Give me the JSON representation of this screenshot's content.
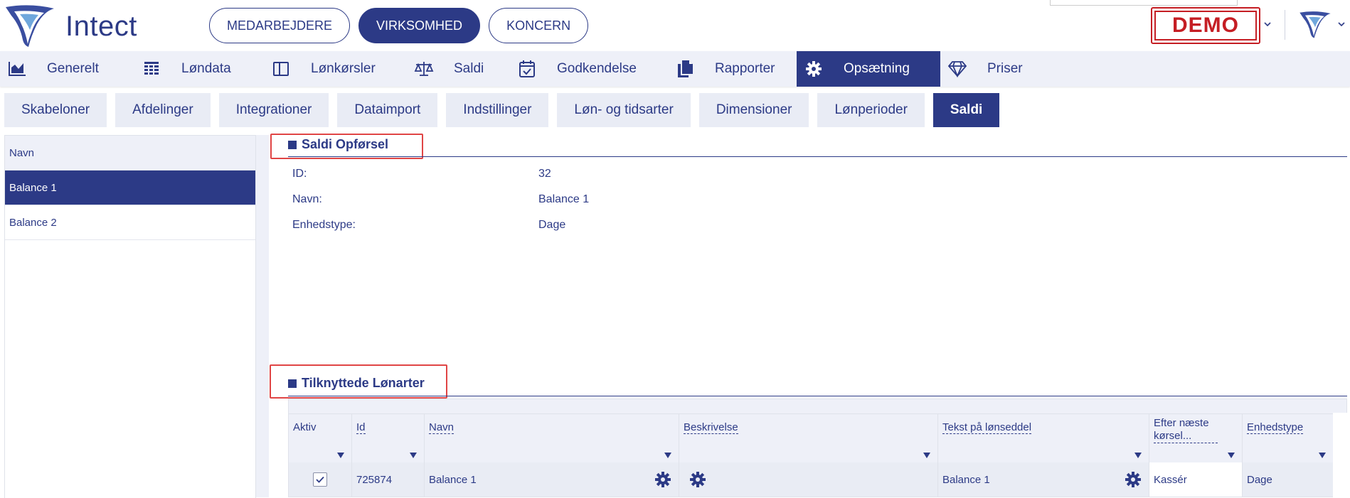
{
  "app": {
    "name": "Intect"
  },
  "modes": [
    {
      "label": "MEDARBEJDERE",
      "active": false
    },
    {
      "label": "VIRKSOMHED",
      "active": true
    },
    {
      "label": "KONCERN",
      "active": false
    }
  ],
  "demo_label": "DEMO",
  "main_nav": [
    {
      "label": "Generelt",
      "icon": "chart-icon",
      "active": false
    },
    {
      "label": "Løndata",
      "icon": "table-icon",
      "active": false
    },
    {
      "label": "Lønkørsler",
      "icon": "window-icon",
      "active": false
    },
    {
      "label": "Saldi",
      "icon": "scale-icon",
      "active": false
    },
    {
      "label": "Godkendelse",
      "icon": "calendar-check-icon",
      "active": false
    },
    {
      "label": "Rapporter",
      "icon": "documents-icon",
      "active": false
    },
    {
      "label": "Opsætning",
      "icon": "gear-icon",
      "active": true
    },
    {
      "label": "Priser",
      "icon": "diamond-icon",
      "active": false
    }
  ],
  "sub_nav": [
    {
      "label": "Skabeloner",
      "active": false
    },
    {
      "label": "Afdelinger",
      "active": false
    },
    {
      "label": "Integrationer",
      "active": false
    },
    {
      "label": "Dataimport",
      "active": false
    },
    {
      "label": "Indstillinger",
      "active": false
    },
    {
      "label": "Løn- og tidsarter",
      "active": false
    },
    {
      "label": "Dimensioner",
      "active": false
    },
    {
      "label": "Lønperioder",
      "active": false
    },
    {
      "label": "Saldi",
      "active": true
    }
  ],
  "left_list": {
    "header": "Navn",
    "items": [
      {
        "label": "Balance 1",
        "selected": true
      },
      {
        "label": "Balance 2",
        "selected": false
      }
    ]
  },
  "details": {
    "title": "Saldi Opførsel",
    "fields": [
      {
        "label": "ID:",
        "value": "32"
      },
      {
        "label": "Navn:",
        "value": "Balance 1"
      },
      {
        "label": "Enhedstype:",
        "value": "Dage"
      }
    ]
  },
  "linked": {
    "title": "Tilknyttede Lønarter",
    "columns": [
      "Aktiv",
      "Id",
      "Navn",
      "Beskrivelse",
      "Tekst på lønseddel",
      "Efter næste kørsel...",
      "Enhedstype"
    ],
    "rows": [
      {
        "aktiv": true,
        "id": "725874",
        "navn": "Balance 1",
        "beskrivelse": "",
        "tekst": "Balance 1",
        "efter": "Kassér",
        "enhedstype": "Dage"
      }
    ]
  },
  "colors": {
    "primary": "#2c3a86",
    "light_bg": "#eef0f8",
    "highlight": "#e04545",
    "demo_red": "#c51e24"
  }
}
